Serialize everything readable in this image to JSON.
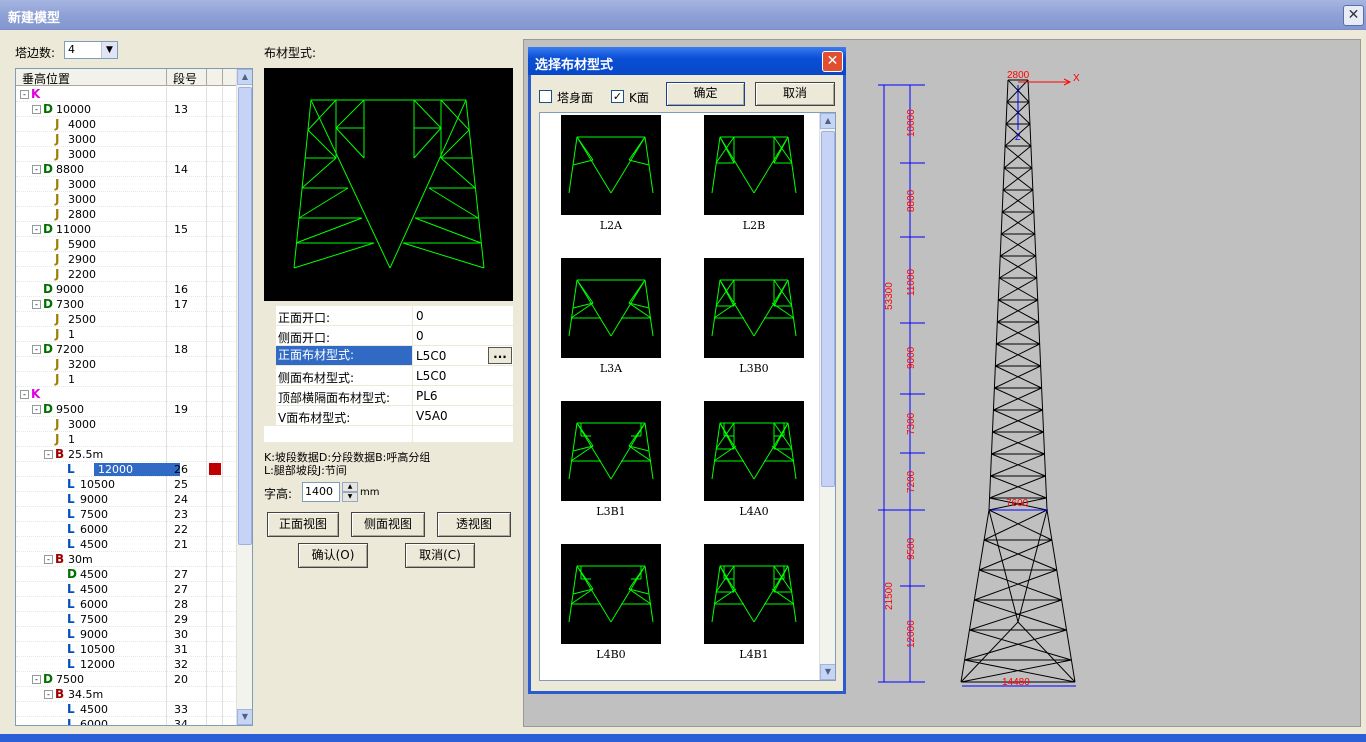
{
  "window": {
    "title": "新建模型",
    "close": "✕"
  },
  "sides": {
    "label": "塔边数:",
    "value": "4"
  },
  "tree": {
    "col_position": "垂高位置",
    "col_segment": "段号",
    "rows": [
      {
        "lvl": 0,
        "exp": "-",
        "tag": "K",
        "color": "#e000e0",
        "text": "",
        "seg": ""
      },
      {
        "lvl": 1,
        "exp": "-",
        "tag": "D",
        "color": "#007000",
        "text": "10000",
        "seg": "13"
      },
      {
        "lvl": 2,
        "exp": "",
        "tag": "J",
        "color": "#a08000",
        "text": "4000",
        "seg": ""
      },
      {
        "lvl": 2,
        "exp": "",
        "tag": "J",
        "color": "#a08000",
        "text": "3000",
        "seg": ""
      },
      {
        "lvl": 2,
        "exp": "",
        "tag": "J",
        "color": "#a08000",
        "text": "3000",
        "seg": ""
      },
      {
        "lvl": 1,
        "exp": "-",
        "tag": "D",
        "color": "#007000",
        "text": "8800",
        "seg": "14"
      },
      {
        "lvl": 2,
        "exp": "",
        "tag": "J",
        "color": "#a08000",
        "text": "3000",
        "seg": ""
      },
      {
        "lvl": 2,
        "exp": "",
        "tag": "J",
        "color": "#a08000",
        "text": "3000",
        "seg": ""
      },
      {
        "lvl": 2,
        "exp": "",
        "tag": "J",
        "color": "#a08000",
        "text": "2800",
        "seg": ""
      },
      {
        "lvl": 1,
        "exp": "-",
        "tag": "D",
        "color": "#007000",
        "text": "11000",
        "seg": "15"
      },
      {
        "lvl": 2,
        "exp": "",
        "tag": "J",
        "color": "#a08000",
        "text": "5900",
        "seg": ""
      },
      {
        "lvl": 2,
        "exp": "",
        "tag": "J",
        "color": "#a08000",
        "text": "2900",
        "seg": ""
      },
      {
        "lvl": 2,
        "exp": "",
        "tag": "J",
        "color": "#a08000",
        "text": "2200",
        "seg": ""
      },
      {
        "lvl": 1,
        "exp": "",
        "tag": "D",
        "color": "#007000",
        "text": "9000",
        "seg": "16"
      },
      {
        "lvl": 1,
        "exp": "-",
        "tag": "D",
        "color": "#007000",
        "text": "7300",
        "seg": "17"
      },
      {
        "lvl": 2,
        "exp": "",
        "tag": "J",
        "color": "#a08000",
        "text": "2500",
        "seg": ""
      },
      {
        "lvl": 2,
        "exp": "",
        "tag": "J",
        "color": "#a08000",
        "text": "1",
        "seg": ""
      },
      {
        "lvl": 1,
        "exp": "-",
        "tag": "D",
        "color": "#007000",
        "text": "7200",
        "seg": "18"
      },
      {
        "lvl": 2,
        "exp": "",
        "tag": "J",
        "color": "#a08000",
        "text": "3200",
        "seg": ""
      },
      {
        "lvl": 2,
        "exp": "",
        "tag": "J",
        "color": "#a08000",
        "text": "1",
        "seg": ""
      },
      {
        "lvl": 0,
        "exp": "-",
        "tag": "K",
        "color": "#e000e0",
        "text": "",
        "seg": ""
      },
      {
        "lvl": 1,
        "exp": "-",
        "tag": "D",
        "color": "#007000",
        "text": "9500",
        "seg": "19"
      },
      {
        "lvl": 2,
        "exp": "",
        "tag": "J",
        "color": "#a08000",
        "text": "3000",
        "seg": ""
      },
      {
        "lvl": 2,
        "exp": "",
        "tag": "J",
        "color": "#a08000",
        "text": "1",
        "seg": ""
      },
      {
        "lvl": 2,
        "exp": "-",
        "tag": "B",
        "color": "#a00000",
        "text": "25.5m",
        "seg": ""
      },
      {
        "lvl": 3,
        "exp": "",
        "tag": "L",
        "color": "#0050c0",
        "text": "12000",
        "seg": "26",
        "sel": true
      },
      {
        "lvl": 3,
        "exp": "",
        "tag": "L",
        "color": "#0050c0",
        "text": "10500",
        "seg": "25"
      },
      {
        "lvl": 3,
        "exp": "",
        "tag": "L",
        "color": "#0050c0",
        "text": "9000",
        "seg": "24"
      },
      {
        "lvl": 3,
        "exp": "",
        "tag": "L",
        "color": "#0050c0",
        "text": "7500",
        "seg": "23"
      },
      {
        "lvl": 3,
        "exp": "",
        "tag": "L",
        "color": "#0050c0",
        "text": "6000",
        "seg": "22"
      },
      {
        "lvl": 3,
        "exp": "",
        "tag": "L",
        "color": "#0050c0",
        "text": "4500",
        "seg": "21"
      },
      {
        "lvl": 2,
        "exp": "-",
        "tag": "B",
        "color": "#a00000",
        "text": "30m",
        "seg": ""
      },
      {
        "lvl": 3,
        "exp": "",
        "tag": "D",
        "color": "#007000",
        "text": "4500",
        "seg": "27"
      },
      {
        "lvl": 3,
        "exp": "",
        "tag": "L",
        "color": "#0050c0",
        "text": "4500",
        "seg": "27"
      },
      {
        "lvl": 3,
        "exp": "",
        "tag": "L",
        "color": "#0050c0",
        "text": "6000",
        "seg": "28"
      },
      {
        "lvl": 3,
        "exp": "",
        "tag": "L",
        "color": "#0050c0",
        "text": "7500",
        "seg": "29"
      },
      {
        "lvl": 3,
        "exp": "",
        "tag": "L",
        "color": "#0050c0",
        "text": "9000",
        "seg": "30"
      },
      {
        "lvl": 3,
        "exp": "",
        "tag": "L",
        "color": "#0050c0",
        "text": "10500",
        "seg": "31"
      },
      {
        "lvl": 3,
        "exp": "",
        "tag": "L",
        "color": "#0050c0",
        "text": "12000",
        "seg": "32"
      },
      {
        "lvl": 1,
        "exp": "-",
        "tag": "D",
        "color": "#007000",
        "text": "7500",
        "seg": "20"
      },
      {
        "lvl": 2,
        "exp": "-",
        "tag": "B",
        "color": "#a00000",
        "text": "34.5m",
        "seg": ""
      },
      {
        "lvl": 3,
        "exp": "",
        "tag": "L",
        "color": "#0050c0",
        "text": "4500",
        "seg": "33"
      },
      {
        "lvl": 3,
        "exp": "",
        "tag": "L",
        "color": "#0050c0",
        "text": "6000",
        "seg": "34"
      }
    ]
  },
  "pattern": {
    "label": "布材型式:",
    "props": [
      {
        "k": "正面开口:",
        "v": "0"
      },
      {
        "k": "侧面开口:",
        "v": "0"
      },
      {
        "k": "正面布材型式:",
        "v": "L5C0",
        "sel": true,
        "btn": "..."
      },
      {
        "k": "侧面布材型式:",
        "v": "L5C0"
      },
      {
        "k": "顶部横隔面布材型式:",
        "v": "PL6"
      },
      {
        "k": "V面布材型式:",
        "v": "V5A0"
      }
    ],
    "legend1": "K:坡段数据D:分段数据B:呼高分组",
    "legend2": "L:腿部坡段J:节间",
    "font_label": "字高:",
    "font_value": "1400",
    "font_unit": "mm",
    "btn_front": "正面视图",
    "btn_side": "侧面视图",
    "btn_persp": "透视图",
    "btn_ok": "确认(O)",
    "btn_cancel": "取消(C)"
  },
  "dialog": {
    "title": "选择布材型式",
    "chk_tower": "塔身面",
    "chk_k": "K面",
    "chk_k_mark": "✓",
    "ok": "确定",
    "cancel": "取消",
    "items": [
      "L2A",
      "L2B",
      "L3A",
      "L3B0",
      "L3B1",
      "L4A0",
      "L4B0",
      "L4B1"
    ]
  },
  "tower": {
    "top_width": "2800",
    "mid_width": "7600",
    "bottom_width": "14480",
    "axis_x": "X",
    "axis_z": "Z",
    "total_upper": "53300",
    "total_lower": "21500",
    "segments": [
      "10000",
      "8800",
      "11000",
      "9000",
      "7300",
      "7200",
      "9500",
      "12000"
    ],
    "colors": {
      "dim": "#ff0000",
      "axis_z": "#0000ff",
      "dimline": "#0000ff"
    }
  },
  "colors": {
    "frame_green": "#00ff00",
    "selection": "#316ac5"
  }
}
